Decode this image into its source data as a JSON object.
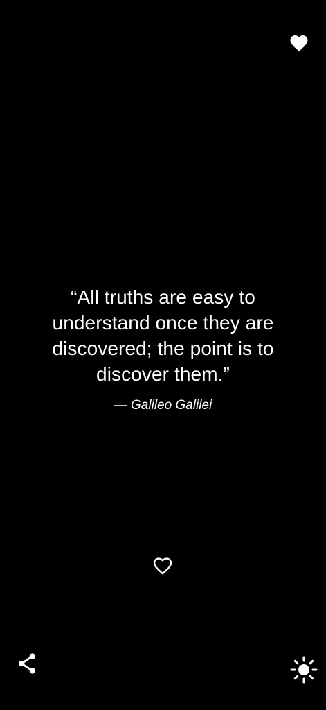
{
  "quote": {
    "text": "“All truths are easy to understand once they are discovered; the point is to discover them.”",
    "author": "— Galileo Galilei"
  },
  "icons": {
    "favorites": "heart-filled-icon",
    "like": "heart-outline-icon",
    "share": "share-icon",
    "theme": "sun-icon"
  },
  "colors": {
    "background": "#000000",
    "foreground": "#ffffff"
  }
}
